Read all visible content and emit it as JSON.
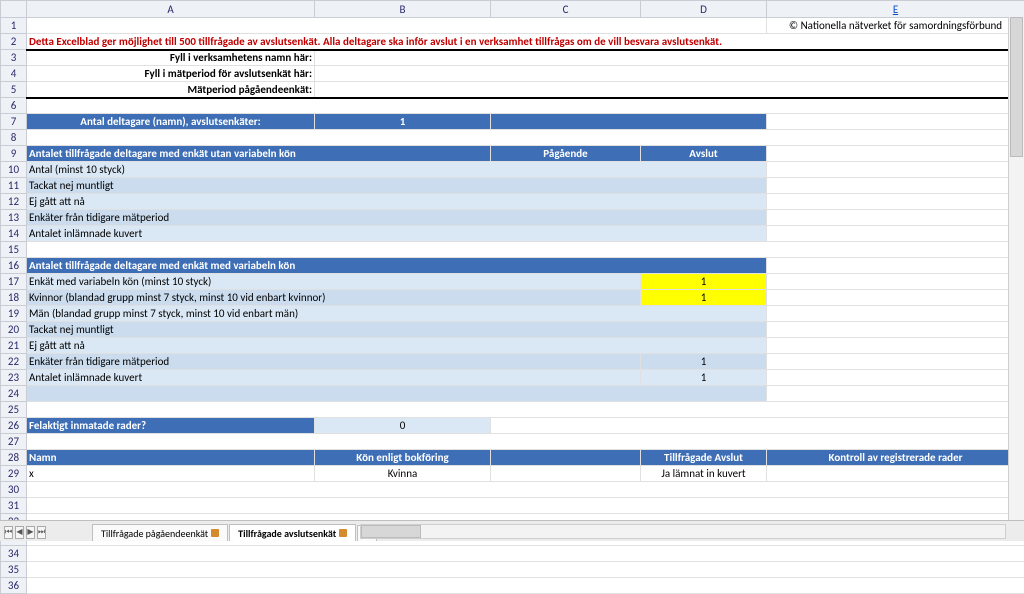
{
  "columns": [
    "A",
    "B",
    "C",
    "D",
    "E"
  ],
  "footer_link": "© Nationella nätverket för samordningsförbund",
  "row2": "Detta Excelblad ger möjlighet till 500 tillfrågade av avslutsenkät. Alla deltagare ska inför avslut i en verksamhet tillfrågas om de vill besvara avslutsenkät.",
  "row3": "Fyll i verksamhetens namn här:",
  "row4": "Fyll i mätperiod för avslutsenkät här:",
  "row5": "Mätperiod pågåendeenkät:",
  "row7A": "Antal deltagare (namn), avslutsenkäter:",
  "row7B": "1",
  "row9A": "Antalet tillfrågade deltagare med enkät utan variabeln kön",
  "row9C": "Pågående",
  "row9D": "Avslut",
  "row10": "Antal (minst 10 styck)",
  "row11": "Tackat nej muntligt",
  "row12": "Ej gått att nå",
  "row13": "Enkäter från tidigare mätperiod",
  "row14": "Antalet inlämnade kuvert",
  "row16": "Antalet tillfrågade deltagare med enkät med variabeln kön",
  "row17": "Enkät med variabeln kön (minst 10 styck)",
  "row17D": "1",
  "row18": "Kvinnor  (blandad grupp minst 7 styck, minst 10 vid enbart kvinnor)",
  "row18D": "1",
  "row19": "Män (blandad grupp minst 7 styck, minst 10 vid enbart män)",
  "row20": "Tackat nej muntligt",
  "row21": "Ej gått att nå",
  "row22": "Enkäter från tidigare mätperiod",
  "row22D": "1",
  "row23": "Antalet inlämnade kuvert",
  "row23D": "1",
  "row26A": "Felaktigt inmatade rader?",
  "row26B": "0",
  "row28A": "Namn",
  "row28B": "Kön enligt bokföring",
  "row28D": "Tillfrågade Avslut",
  "row28E": "Kontroll av registrerade rader",
  "row29A": "x",
  "row29B": "Kvinna",
  "row29D": "Ja lämnat in kuvert",
  "tabs": {
    "t1": "Tillfrågade pågåendeenkät",
    "t2": "Tillfrågade avslutsenkät"
  }
}
